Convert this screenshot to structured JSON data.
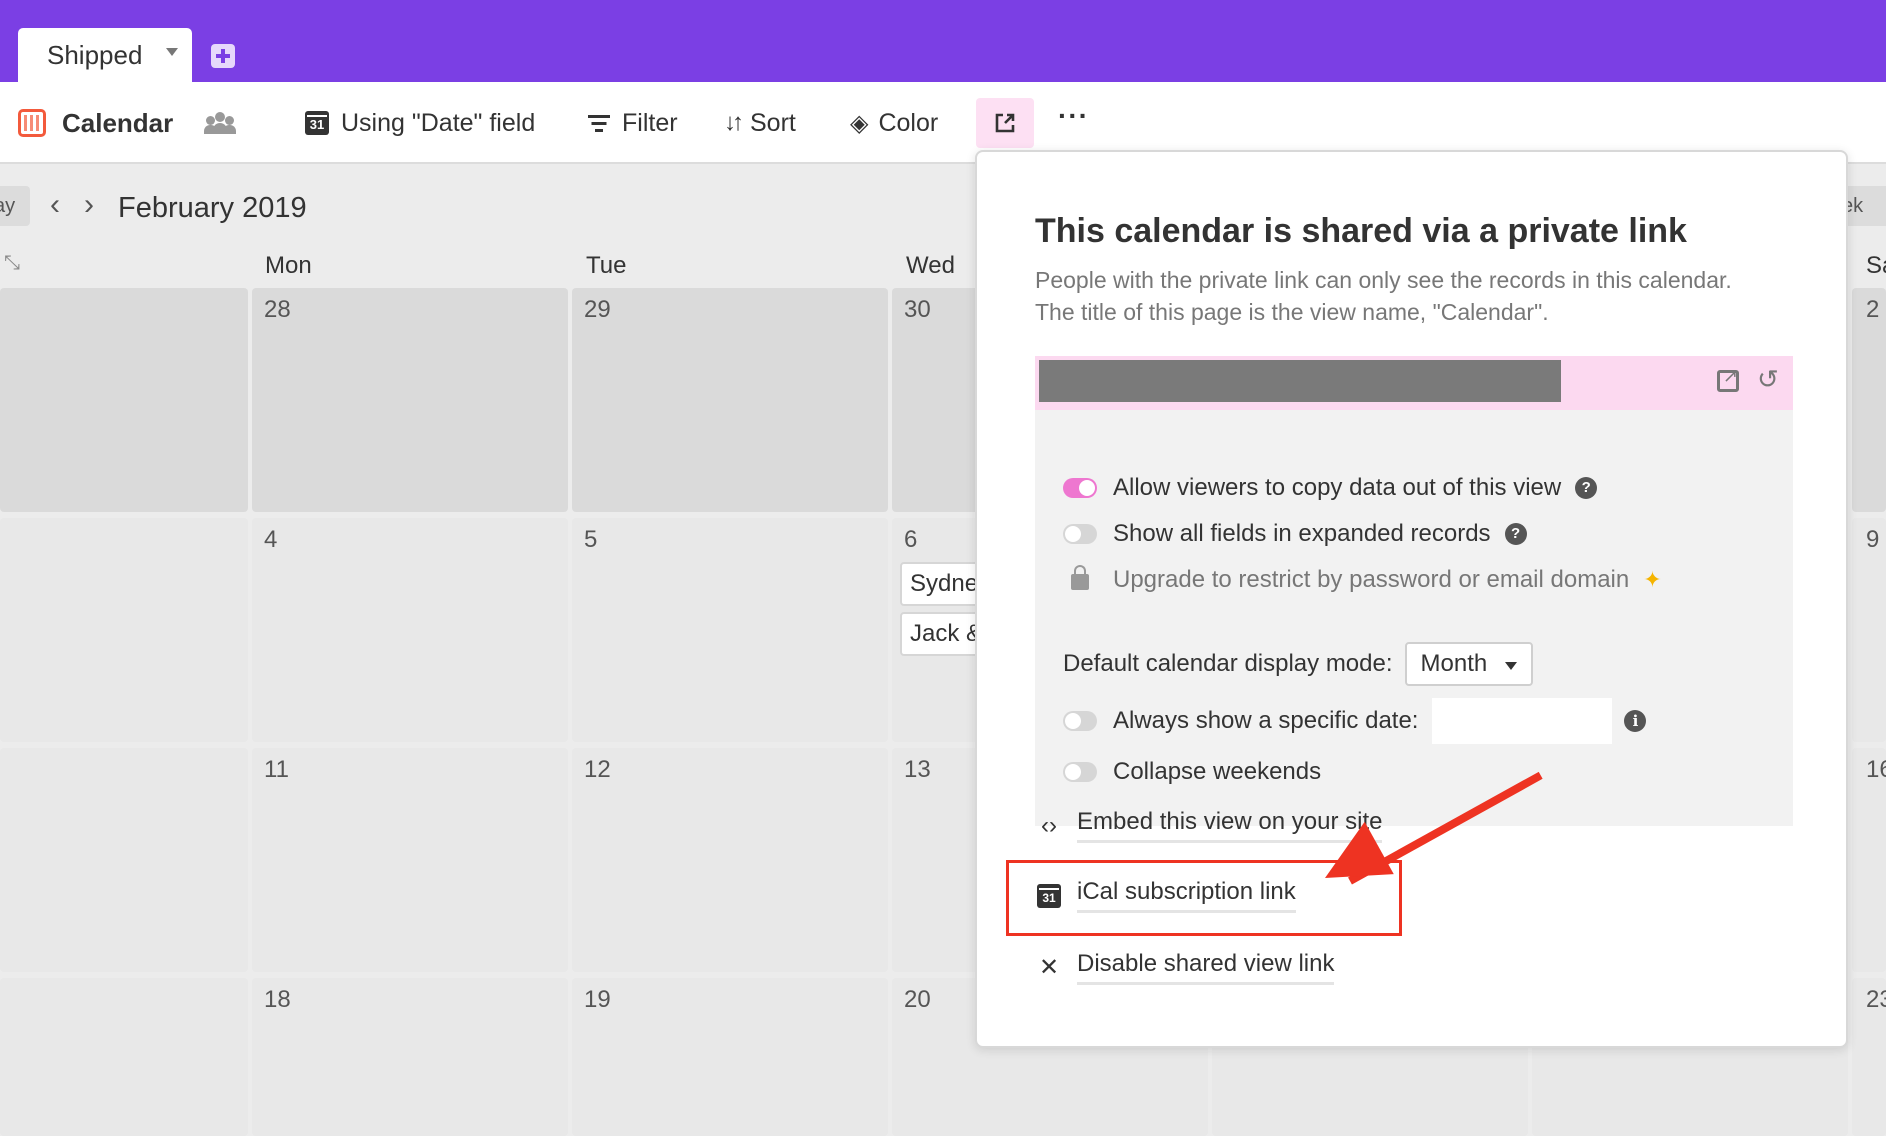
{
  "tabs": {
    "active": "Shipped"
  },
  "toolbar": {
    "view_name": "Calendar",
    "date_field": "Using \"Date\" field",
    "filter": "Filter",
    "sort": "Sort",
    "color": "Color",
    "more": "···"
  },
  "calendar": {
    "today_partial": "ay",
    "week_partial": "ek",
    "month": "February 2019",
    "days": [
      "Mon",
      "Tue",
      "Wed",
      "Sa"
    ],
    "rows": [
      [
        "28",
        "29",
        "30",
        "2"
      ],
      [
        "4",
        "5",
        "6",
        "9"
      ],
      [
        "11",
        "12",
        "13",
        "16"
      ],
      [
        "18",
        "19",
        "20",
        "23"
      ]
    ],
    "events": [
      "Sydne",
      "Jack &"
    ]
  },
  "share": {
    "title": "This calendar is shared via a private link",
    "description": "People with the private link can only see the records in this calendar. The title of this page is the view name, \"Calendar\".",
    "options": {
      "copy_data": "Allow viewers to copy data out of this view",
      "show_fields": "Show all fields in expanded records",
      "upgrade": "Upgrade to restrict by password or email domain",
      "display_mode_label": "Default calendar display mode:",
      "display_mode_value": "Month",
      "specific_date": "Always show a specific date:",
      "collapse_weekends": "Collapse weekends"
    },
    "actions": {
      "embed": "Embed this view on your site",
      "ical": "iCal subscription link",
      "disable": "Disable shared view link"
    }
  },
  "colors": {
    "brand": "#7b3fe4",
    "accent_pink": "#ee77d0",
    "annotation": "#ee3322"
  }
}
